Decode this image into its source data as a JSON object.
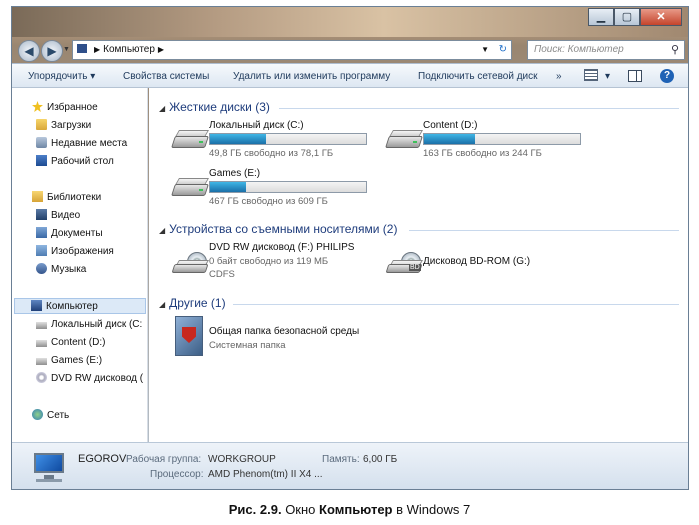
{
  "window": {
    "controls": {
      "minimize": "▁",
      "maximize": "▢",
      "close": "✕"
    }
  },
  "address_bar": {
    "back_icon": "back-arrow-icon",
    "forward_icon": "forward-arrow-icon",
    "path": "Компьютер",
    "search_placeholder": "Поиск: Компьютер"
  },
  "toolbar": {
    "organize": "Упорядочить ▾",
    "system_properties": "Свойства системы",
    "uninstall": "Удалить или изменить программу",
    "map_drive": "Подключить сетевой диск",
    "more": "»",
    "view_dd": "▾"
  },
  "nav": {
    "favorites": "Избранное",
    "downloads": "Загрузки",
    "recent": "Недавние места",
    "desktop": "Рабочий стол",
    "libraries": "Библиотеки",
    "video": "Видео",
    "documents": "Документы",
    "pictures": "Изображения",
    "music": "Музыка",
    "computer": "Компьютер",
    "local_c": "Локальный диск (C:",
    "content_d": "Content (D:)",
    "games_e": "Games (E:)",
    "dvd_f": "DVD RW дисковод (",
    "network": "Сеть"
  },
  "groups": {
    "hard_drives": "Жесткие диски (3)",
    "removable": "Устройства со съемными носителями (2)",
    "other": "Другие (1)"
  },
  "drives": {
    "c": {
      "name": "Локальный диск (C:)",
      "free": "49,8 ГБ свободно из 78,1 ГБ",
      "used_fraction": 0.36
    },
    "d": {
      "name": "Content (D:)",
      "free": "163 ГБ свободно из 244 ГБ",
      "used_fraction": 0.33
    },
    "e": {
      "name": "Games (E:)",
      "free": "467 ГБ свободно из 609 ГБ",
      "used_fraction": 0.23
    },
    "f": {
      "name": "DVD RW дисковод (F:) PHILIPS",
      "free": "0 байт свободно из 119 МБ",
      "fs": "CDFS"
    },
    "g": {
      "name": "Дисковод BD-ROM (G:)",
      "badge": "BD"
    },
    "shared": {
      "name": "Общая папка безопасной среды",
      "type": "Системная папка"
    }
  },
  "details": {
    "computer_name": "EGOROV",
    "workgroup_label": "Рабочая группа:",
    "workgroup": "WORKGROUP",
    "memory_label": "Память:",
    "memory": "6,00 ГБ",
    "cpu_label": "Процессор:",
    "cpu": "AMD Phenom(tm) II X4 ..."
  },
  "caption": {
    "prefix": "Рис. 2.9.",
    "middle": " Окно ",
    "bold": "Компьютер",
    "suffix": " в Windows 7"
  },
  "colors": {
    "accent": "#1e3c7c",
    "bar_fill": "#2a8fc8",
    "selection": "#dce9f7"
  }
}
